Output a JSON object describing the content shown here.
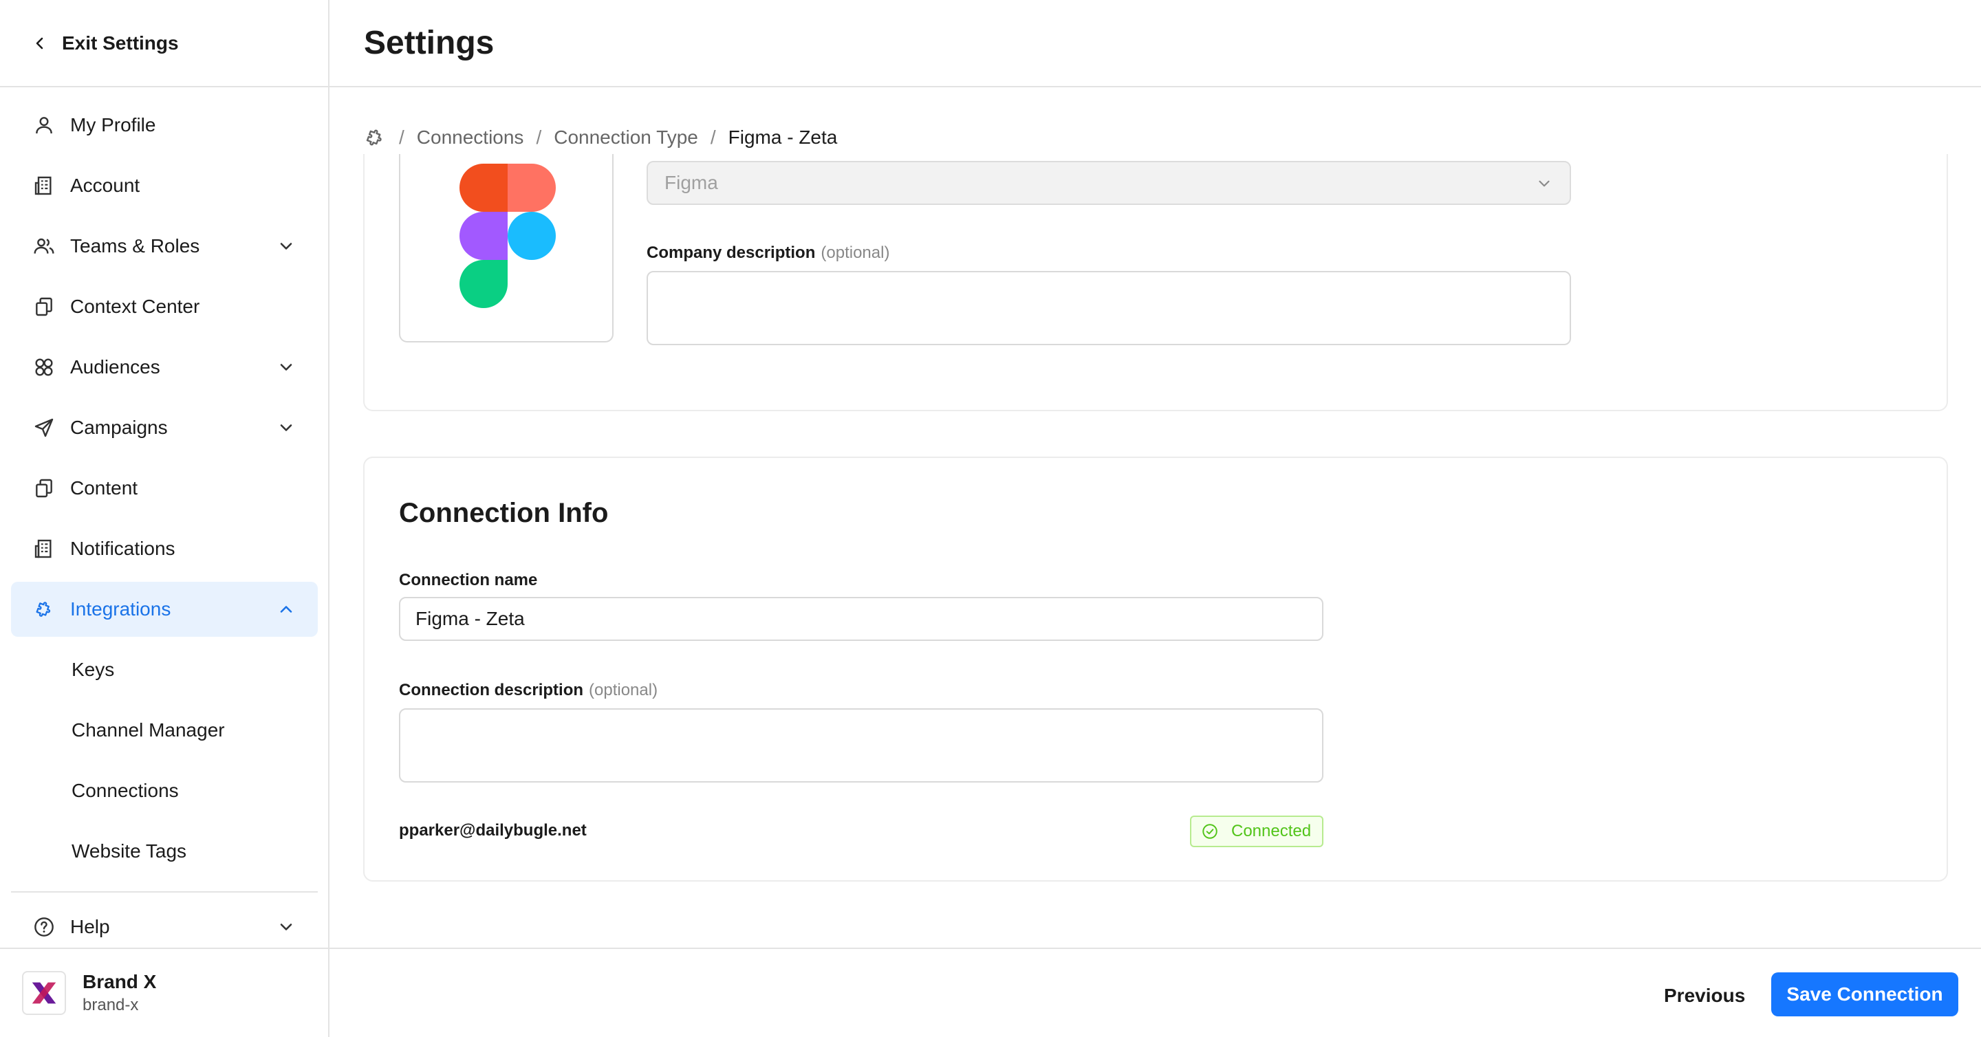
{
  "header": {
    "title": "Settings"
  },
  "sidebar": {
    "exit_label": "Exit Settings",
    "items": [
      {
        "label": "My Profile",
        "icon": "user-icon"
      },
      {
        "label": "Account",
        "icon": "building-icon"
      },
      {
        "label": "Teams & Roles",
        "icon": "users-icon",
        "expandable": true
      },
      {
        "label": "Context Center",
        "icon": "copy-icon"
      },
      {
        "label": "Audiences",
        "icon": "audiences-icon",
        "expandable": true
      },
      {
        "label": "Campaigns",
        "icon": "send-icon",
        "expandable": true
      },
      {
        "label": "Content",
        "icon": "copy-icon"
      },
      {
        "label": "Notifications",
        "icon": "building-icon"
      },
      {
        "label": "Integrations",
        "icon": "puzzle-icon",
        "expanded": true,
        "active": true
      }
    ],
    "sub_items": [
      {
        "label": "Keys"
      },
      {
        "label": "Channel Manager"
      },
      {
        "label": "Connections"
      },
      {
        "label": "Website Tags"
      }
    ],
    "help_label": "Help",
    "brand": {
      "name": "Brand X",
      "slug": "brand-x"
    }
  },
  "breadcrumb": {
    "icon": "puzzle-icon",
    "items": [
      "Connections",
      "Connection Type",
      "Figma - Zeta"
    ]
  },
  "company": {
    "selected_app": "Figma",
    "description_label": "Company description",
    "description_optional": "(optional)",
    "description_value": ""
  },
  "connection_info": {
    "title": "Connection Info",
    "name_label": "Connection name",
    "name_value": "Figma - Zeta",
    "description_label": "Connection description",
    "description_optional": "(optional)",
    "description_value": "",
    "account_email": "pparker@dailybugle.net",
    "status": "Connected",
    "status_color": "#52c41a"
  },
  "footer": {
    "previous_label": "Previous",
    "save_label": "Save Connection"
  },
  "colors": {
    "accent": "#1677ff",
    "active_bg": "#e8f2fe",
    "active_text": "#1a73e8"
  }
}
